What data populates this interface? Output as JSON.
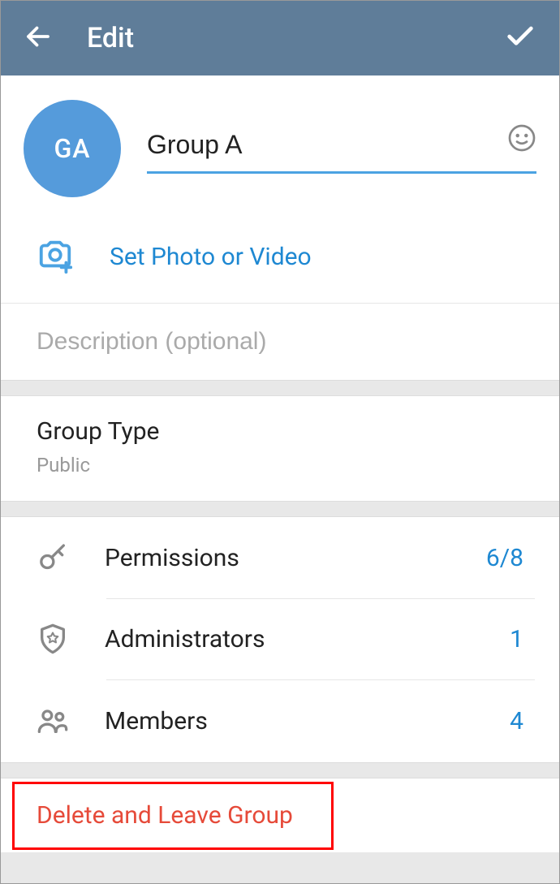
{
  "header": {
    "title": "Edit"
  },
  "group": {
    "avatar_initials": "GA",
    "name_value": "Group A"
  },
  "photo": {
    "label": "Set Photo or Video"
  },
  "description": {
    "placeholder": "Description (optional)"
  },
  "group_type": {
    "label": "Group Type",
    "value": "Public"
  },
  "rows": {
    "permissions": {
      "label": "Permissions",
      "value": "6/8"
    },
    "administrators": {
      "label": "Administrators",
      "value": "1"
    },
    "members": {
      "label": "Members",
      "value": "4"
    }
  },
  "delete": {
    "label": "Delete and Leave Group"
  }
}
